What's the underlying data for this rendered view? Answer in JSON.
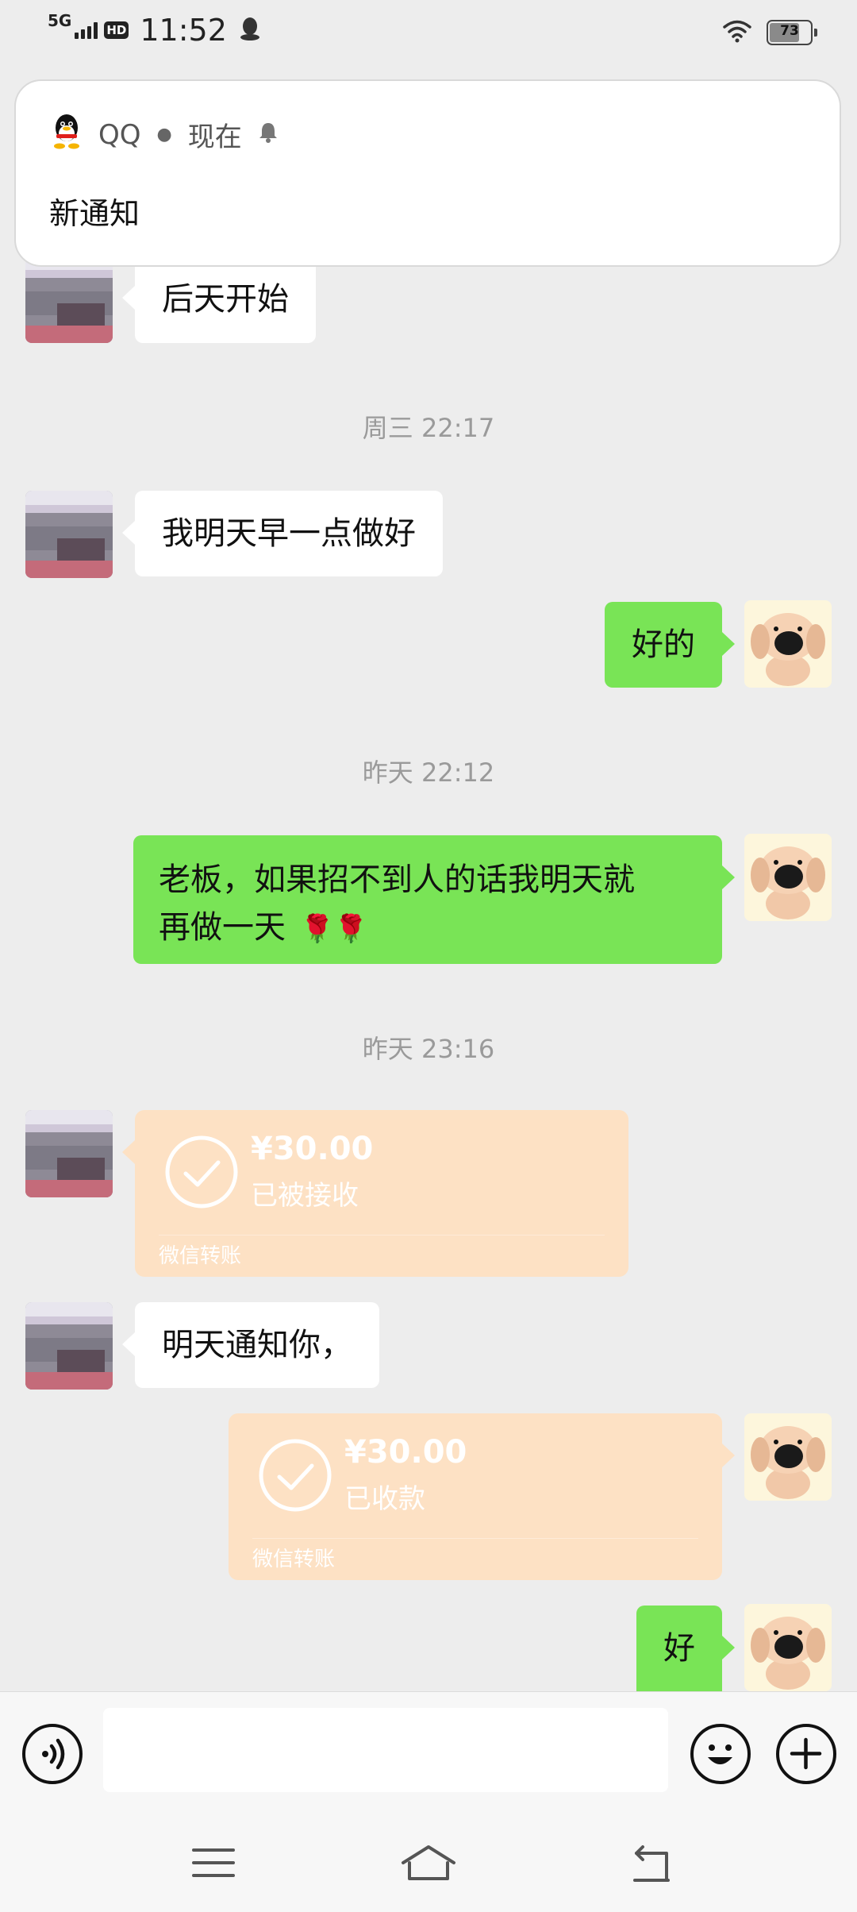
{
  "status_bar": {
    "network": "5G",
    "hd": "HD",
    "time": "11:52",
    "battery": "73",
    "battery_fraction": 0.73
  },
  "notification": {
    "app": "QQ",
    "when": "现在",
    "title": "新通知"
  },
  "messages": {
    "m1_text": "后天开始",
    "t1": "周三 22:17",
    "m2_text": "我明天早一点做好",
    "m3_text": "好的",
    "t2": "昨天 22:12",
    "m4_line1": "老板，如果招不到人的话我明天就",
    "m4_line2": "再做一天",
    "m4_emoji": "🌹🌹",
    "t3": "昨天 23:16",
    "transfer1": {
      "amount": "¥30.00",
      "status": "已被接收",
      "label": "微信转账"
    },
    "m6_text": "明天通知你，",
    "transfer2": {
      "amount": "¥30.00",
      "status": "已收款",
      "label": "微信转账"
    },
    "m8_text": "好"
  },
  "input_bar": {
    "voice_icon": "voice-icon",
    "emoji_icon": "emoji-icon",
    "plus_icon": "plus-icon",
    "text_value": ""
  },
  "nav": {
    "menu_icon": "menu-icon",
    "home_icon": "home-icon",
    "back_icon": "back-icon"
  },
  "colors": {
    "background": "#ededed",
    "outgoing_bubble": "#79e456",
    "incoming_bubble": "#ffffff",
    "transfer_card": "#fde1c4"
  }
}
